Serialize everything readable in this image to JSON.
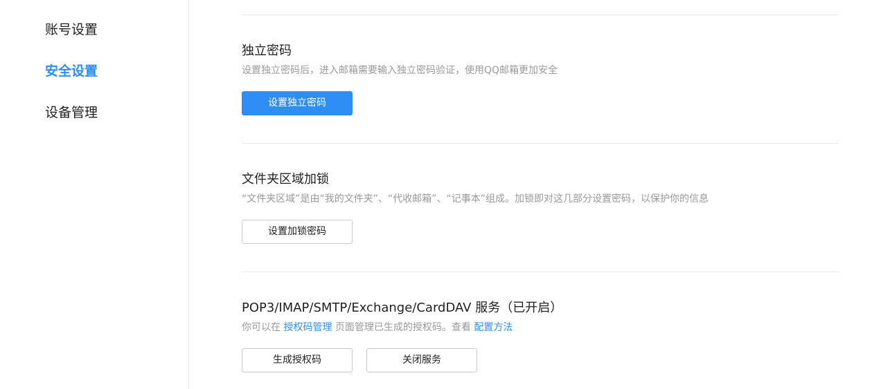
{
  "sidebar": {
    "items": [
      {
        "label": "账号设置",
        "active": false
      },
      {
        "label": "安全设置",
        "active": true
      },
      {
        "label": "设备管理",
        "active": false
      }
    ]
  },
  "sections": {
    "independent_password": {
      "title": "独立密码",
      "description": "设置独立密码后，进入邮箱需要输入独立密码验证，使用QQ邮箱更加安全",
      "button": "设置独立密码"
    },
    "folder_lock": {
      "title": "文件夹区域加锁",
      "description": "“文件夹区域”是由“我的文件夹”、“代收邮箱”、“记事本”组成。加锁即对这几部分设置密码，以保护你的信息",
      "button": "设置加锁密码"
    },
    "pop3_service": {
      "title": "POP3/IMAP/SMTP/Exchange/CardDAV 服务（已开启）",
      "desc_prefix": "你可以在 ",
      "auth_link": "授权码管理",
      "desc_middle": " 页面管理已生成的授权码。查看 ",
      "config_link": "配置方法",
      "generate_button": "生成授权码",
      "close_button": "关闭服务"
    }
  },
  "colors": {
    "accent": "#2f8ef5",
    "text": "#1f1f1f",
    "muted": "#999999",
    "divider": "#e8e8e8"
  }
}
